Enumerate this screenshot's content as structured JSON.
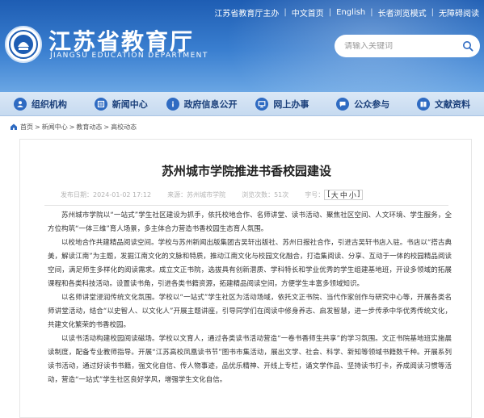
{
  "header": {
    "top_links": [
      "江苏省教育厅主办",
      "中文首页",
      "English",
      "长者浏览模式",
      "无障碍阅读"
    ],
    "title": "江苏省教育厅",
    "subtitle": "JIANGSU EDUCATION DEPARTMENT",
    "search_placeholder": "请输入关键词"
  },
  "nav": {
    "items": [
      {
        "label": "组织机构",
        "icon": "people-icon"
      },
      {
        "label": "新闻中心",
        "icon": "news-icon"
      },
      {
        "label": "政府信息公开",
        "icon": "info-icon"
      },
      {
        "label": "网上办事",
        "icon": "monitor-icon"
      },
      {
        "label": "公众参与",
        "icon": "chat-icon"
      },
      {
        "label": "文献资料",
        "icon": "book-icon"
      }
    ]
  },
  "breadcrumb": [
    "首页",
    "新闻中心",
    "教育动态",
    "高校动态"
  ],
  "article": {
    "title": "苏州城市学院推进书香校园建设",
    "publish_label": "发布日期：",
    "publish_date": "2024-01-02 17:12",
    "source_label": "来源：",
    "source": "苏州城市学院",
    "views_label": "浏览次数：",
    "views": "51次",
    "font_size_label": "字号：",
    "font_sizes": [
      "大",
      "中",
      "小"
    ],
    "paragraphs": [
      "苏州城市学院以“一站式”学生社区建设为抓手，依托校地合作、名师讲堂、读书活动、聚焦社区空间、人文环境、学生服务，全方位构筑“一体三维”育人场景，多主体合力营造书香校园生态育人氛围。",
      "以校地合作共建精品阅读空间。学校与苏州新闻出版集团古吴轩出版社、苏州日报社合作，引进古吴轩书店入驻。书店以“搭古典美，解读江南”为主题，发掘江南文化的文脉和特质，推动江南文化与校园文化融合，打造集阅读、分享、互动于一体的校园精品阅读空间，满足师生多样化的阅读需求。成立文正书院，选拔具有创新潜质、学科特长和学业优秀的学生组建基地班，开设多领域的拓展课程和各类科技活动。设置读书角，引进各类书籍资源，拓建精品阅读空间，方便学生丰富多领域知识。",
      "以名师讲堂浸润传统文化氛围。学校以“一站式”学生社区为活动场域，依托文正书院、当代作家创作与研究中心等，开展各类名师讲堂活动，结合“以史智人、以文化人”开展主题讲座，引导同学们在阅读中修身养志、启发智慧，进一步传承中华优秀传统文化，共建文化繁荣的书香校园。",
      "以读书活动构建校园阅读磁场。学校以文育人，通过各类读书活动营造“一卷书香师生共享”的学习氛围。文正书院基地班实施晨读制度，配备专业教师指导。开展“江苏高校凤凰读书节”图书市集活动，展出文学、社会、科学、新知等领域书籍数千种。开展系列读书活动，通过好读书书籍，强文化自信、传人物事迹，品优乐精神、开线上专栏，诵文学作品、坚持读书打卡，养成阅读习惯等活动，营造“一站式”学生社区良好学风，增强学生文化自信。"
    ]
  },
  "colors": {
    "header_blue": "#1e5db3",
    "nav_text": "#1a3f7a"
  }
}
